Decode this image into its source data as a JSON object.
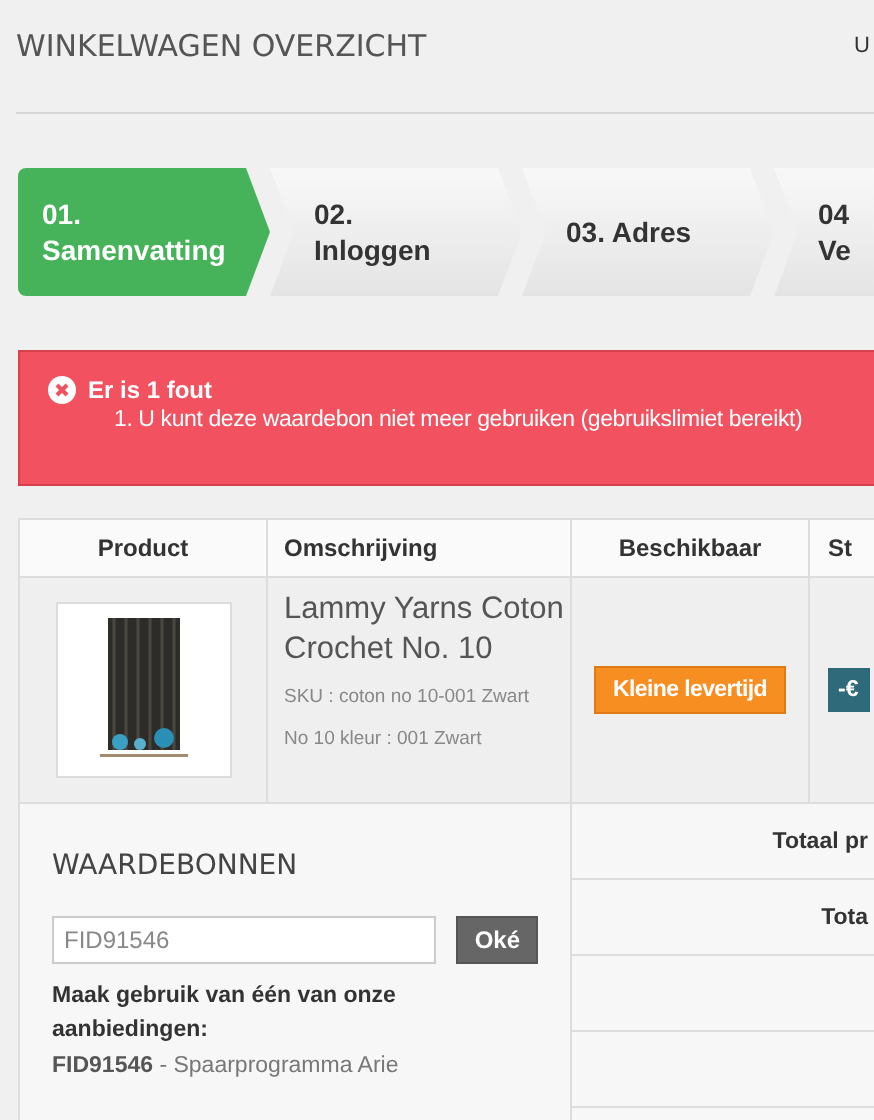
{
  "header": {
    "title": "WINKELWAGEN OVERZICHT",
    "account_link": "U"
  },
  "steps": [
    {
      "lines": [
        "01.",
        "Samenvatting"
      ],
      "selected": true
    },
    {
      "lines": [
        "02.",
        "Inloggen"
      ],
      "selected": false
    },
    {
      "lines": [
        "03. Adres"
      ],
      "selected": false
    },
    {
      "lines": [
        "04",
        "Ve"
      ],
      "selected": false
    }
  ],
  "alert": {
    "title": "Er is 1 fout",
    "messages": [
      "1. U kunt deze waardebon niet meer gebruiken (gebruikslimiet bereikt)"
    ]
  },
  "table": {
    "columns": [
      "Product",
      "Omschrijving",
      "Beschikbaar",
      "St"
    ],
    "rows": [
      {
        "name": "Lammy Yarns Coton Crochet No. 10",
        "sku": "SKU : coton no 10-001 Zwart",
        "attribute": "No 10 kleur : 001 Zwart",
        "availability": "Kleine levertijd",
        "price_badge": "-€"
      }
    ]
  },
  "vouchers": {
    "title": "WAARDEBONNEN",
    "code_value": "FID91546",
    "submit": "Oké",
    "offers_label": "Maak gebruik van één van onze aanbiedingen:",
    "offers": [
      "**FID91546** - Spaarprogramma Arie"
    ]
  },
  "totals": [
    "Totaal pr",
    "Tota"
  ]
}
